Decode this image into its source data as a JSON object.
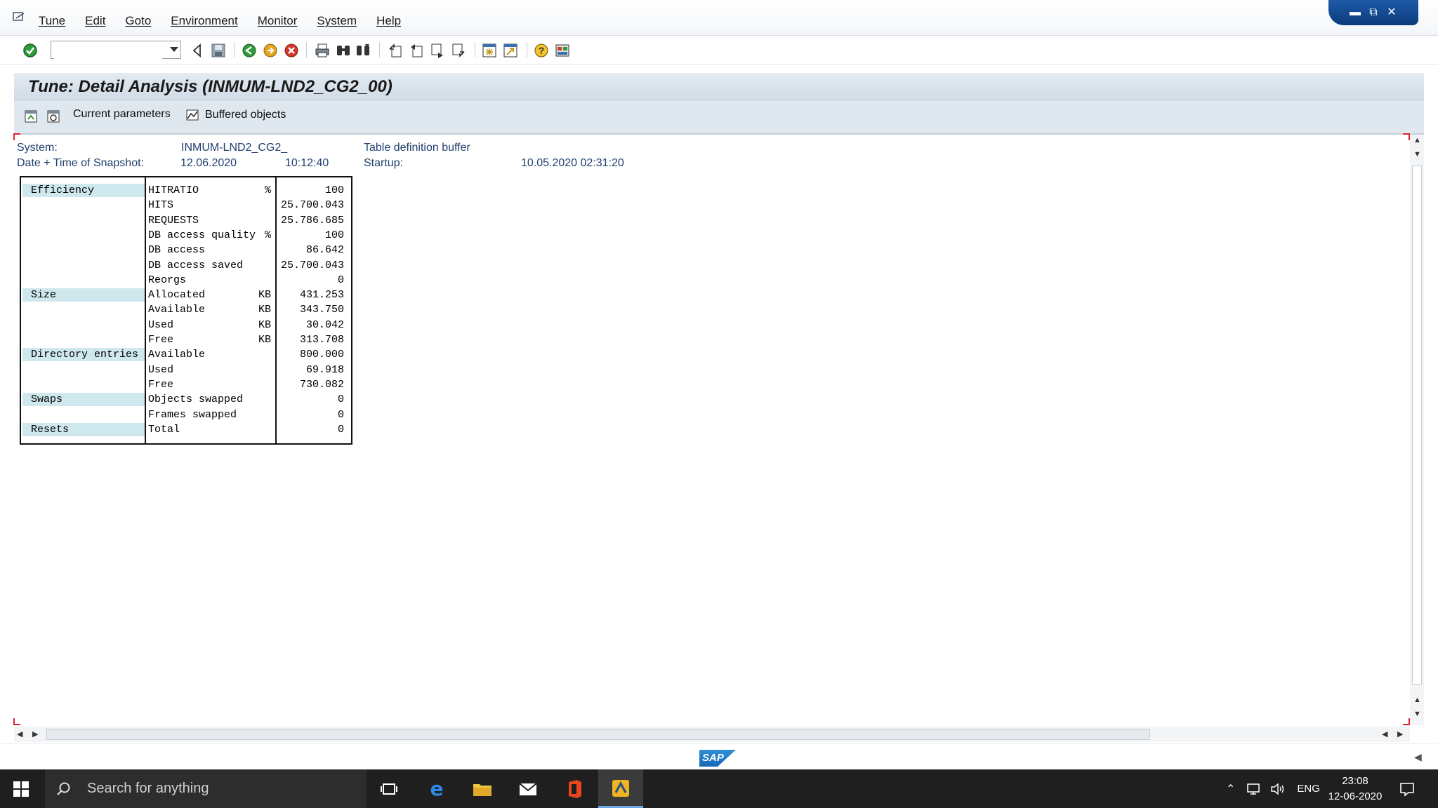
{
  "menu": {
    "items": [
      "Tune",
      "Edit",
      "Goto",
      "Environment",
      "Monitor",
      "System",
      "Help"
    ]
  },
  "toolbar": {
    "command_field_value": ""
  },
  "title": "Tune: Detail Analysis (INMUM-LND2_CG2_00)",
  "app_toolbar": {
    "current_parameters": "Current parameters",
    "buffered_objects": "Buffered objects"
  },
  "info": {
    "system_label": "System:",
    "system_value": "INMUM-LND2_CG2_",
    "buffer_name": "Table definition buffer",
    "snapshot_label": "Date + Time of Snapshot:",
    "snapshot_date": "12.06.2020",
    "snapshot_time": "10:12:40",
    "startup_label": "Startup:",
    "startup_value": "10.05.2020 02:31:20"
  },
  "grid": {
    "rows": [
      {
        "category": "Efficiency",
        "label": "HITRATIO",
        "unit": "%",
        "value": "100"
      },
      {
        "category": "",
        "label": "HITS",
        "unit": "",
        "value": "25.700.043"
      },
      {
        "category": "",
        "label": "REQUESTS",
        "unit": "",
        "value": "25.786.685"
      },
      {
        "category": "",
        "label": "DB access quality",
        "unit": "%",
        "value": "100"
      },
      {
        "category": "",
        "label": "DB access",
        "unit": "",
        "value": "86.642"
      },
      {
        "category": "",
        "label": "DB access saved",
        "unit": "",
        "value": "25.700.043"
      },
      {
        "category": "",
        "label": "Reorgs",
        "unit": "",
        "value": "0"
      },
      {
        "category": "Size",
        "label": "Allocated",
        "unit": "KB",
        "value": "431.253"
      },
      {
        "category": "",
        "label": "Available",
        "unit": "KB",
        "value": "343.750"
      },
      {
        "category": "",
        "label": "Used",
        "unit": "KB",
        "value": "30.042"
      },
      {
        "category": "",
        "label": "Free",
        "unit": "KB",
        "value": "313.708"
      },
      {
        "category": "Directory entries",
        "label": "Available",
        "unit": "",
        "value": "800.000"
      },
      {
        "category": "",
        "label": "Used",
        "unit": "",
        "value": "69.918"
      },
      {
        "category": "",
        "label": "Free",
        "unit": "",
        "value": "730.082"
      },
      {
        "category": "Swaps",
        "label": "Objects swapped",
        "unit": "",
        "value": "0"
      },
      {
        "category": "",
        "label": "Frames swapped",
        "unit": "",
        "value": "0"
      },
      {
        "category": "Resets",
        "label": "Total",
        "unit": "",
        "value": "0"
      }
    ]
  },
  "statusbar": {
    "logo_text": "SAP"
  },
  "taskbar": {
    "search_placeholder": "Search for anything",
    "language": "ENG",
    "time": "23:08",
    "date": "12-06-2020"
  },
  "colors": {
    "accent": "#1668b5",
    "category_bg": "#cfe8ee",
    "title_bg": "#d6e0ea",
    "taskbar": "#1f1f1f"
  }
}
